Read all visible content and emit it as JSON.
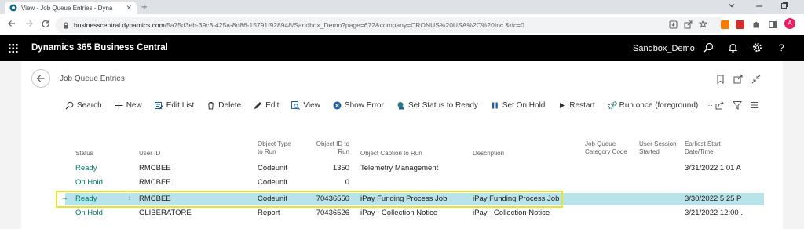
{
  "browser": {
    "tab_title": "View - Job Queue Entries - Dyna",
    "tab_close": "✕",
    "new_tab": "+",
    "url_host": "businesscentral.dynamics.com",
    "url_path": "/5a75d3eb-39c3-425a-8d86-15791f928948/Sandbox_Demo?page=672&company=CRONUS%20USA%2C%20Inc.&dc=0",
    "profile_initial": "A"
  },
  "app": {
    "name": "Dynamics 365 Business Central",
    "environment": "Sandbox_Demo"
  },
  "page": {
    "title": "Job Queue Entries"
  },
  "actions": [
    {
      "label": "Search",
      "icon": "search-icon"
    },
    {
      "label": "New",
      "icon": "plus-icon"
    },
    {
      "label": "Edit List",
      "icon": "edit-list-icon"
    },
    {
      "label": "Delete",
      "icon": "trash-icon"
    },
    {
      "label": "Edit",
      "icon": "pencil-icon"
    },
    {
      "label": "View",
      "icon": "view-icon"
    },
    {
      "label": "Show Error",
      "icon": "error-icon"
    },
    {
      "label": "Set Status to Ready",
      "icon": "status-icon"
    },
    {
      "label": "Set On Hold",
      "icon": "pause-icon"
    },
    {
      "label": "Restart",
      "icon": "play-icon"
    },
    {
      "label": "Run once (foreground)",
      "icon": "gears-icon"
    }
  ],
  "more_label": "···",
  "columns": {
    "status": "Status",
    "user_id": "User ID",
    "object_type_1": "Object Type",
    "object_type_2": "to Run",
    "object_id_1": "Object ID to",
    "object_id_2": "Run",
    "caption": "Object Caption to Run",
    "description": "Description",
    "category_1": "Job Queue",
    "category_2": "Category Code",
    "session_1": "User Session",
    "session_2": "Started",
    "start_1": "Earliest Start",
    "start_2": "Date/Time"
  },
  "rows": [
    {
      "status": "Ready",
      "user": "RMCBEE",
      "type": "Codeunit",
      "id": "1350",
      "caption": "Telemetry Management",
      "desc": "",
      "start": "3/31/2022 1:01 A"
    },
    {
      "status": "On Hold",
      "user": "RMCBEE",
      "type": "Codeunit",
      "id": "0",
      "caption": "",
      "desc": "",
      "start": ""
    },
    {
      "status": "Ready",
      "user": "RMCBEE",
      "type": "Codeunit",
      "id": "70436550",
      "caption": "iPay Funding Process Job",
      "desc": "iPay Funding Process Job",
      "start": "3/30/2022 5:25 P"
    },
    {
      "status": "On Hold",
      "user": "GLIBERATORE",
      "type": "Report",
      "id": "70436526",
      "caption": "iPay - Collection Notice",
      "desc": "iPay - Collection Notice",
      "start": "3/21/2022 12:00 ."
    }
  ],
  "colors": {
    "accent": "#00796b",
    "selected_row": "#b8e4e9",
    "highlight_box": "#e6e62e"
  }
}
